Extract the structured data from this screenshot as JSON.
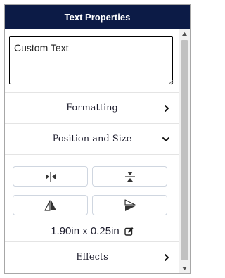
{
  "panel": {
    "title": "Text Properties"
  },
  "text_input": {
    "value": "Custom Text"
  },
  "sections": {
    "formatting": {
      "label": "Formatting",
      "icon": "chevron-right-icon"
    },
    "position_and_size": {
      "label": "Position and Size",
      "icon": "chevron-down-icon"
    },
    "effects": {
      "label": "Effects",
      "icon": "chevron-right-icon"
    }
  },
  "transform_buttons": [
    {
      "icon": "flip-horizontal-center-icon"
    },
    {
      "icon": "flip-vertical-center-icon"
    },
    {
      "icon": "mirror-horizontal-icon"
    },
    {
      "icon": "mirror-vertical-icon"
    }
  ],
  "size": {
    "text": "1.90in x 0.25in",
    "icon": "edit-icon"
  },
  "colors": {
    "header_bg": "#0c1b46",
    "header_text": "#ffffff"
  }
}
